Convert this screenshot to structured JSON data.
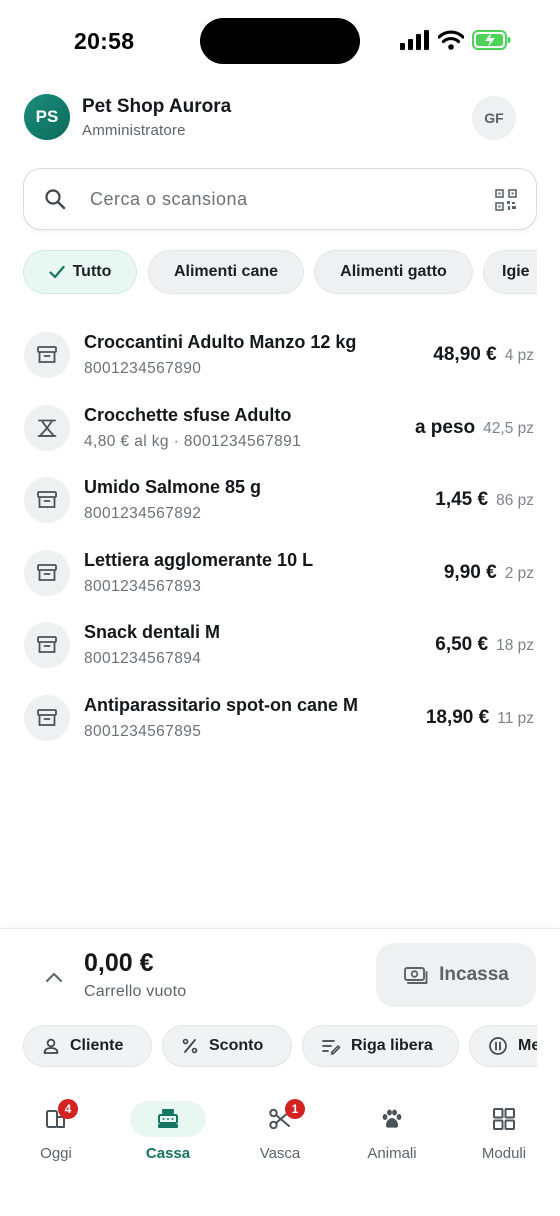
{
  "status_bar": {
    "time": "20:58"
  },
  "header": {
    "avatar_initials": "PS",
    "shop_name": "Pet Shop Aurora",
    "role": "Amministratore",
    "user_initials": "GF"
  },
  "search": {
    "placeholder": "Cerca o scansiona",
    "value": ""
  },
  "categories": [
    {
      "label": "Tutto",
      "active": true
    },
    {
      "label": "Alimenti cane",
      "active": false
    },
    {
      "label": "Alimenti gatto",
      "active": false
    },
    {
      "label": "Igie",
      "active": false
    }
  ],
  "products": [
    {
      "name": "Croccantini Adulto Manzo 12 kg",
      "subtitle": "8001234567890",
      "price": "48,90 €",
      "stock": "4 pz",
      "icon": "archive-box-icon"
    },
    {
      "name": "Crocchette sfuse Adulto",
      "subtitle": "4,80 € al kg · 8001234567891",
      "price": "a peso",
      "stock": "42,5 pz",
      "icon": "scale-icon"
    },
    {
      "name": "Umido Salmone 85 g",
      "subtitle": "8001234567892",
      "price": "1,45 €",
      "stock": "86 pz",
      "icon": "archive-box-icon"
    },
    {
      "name": "Lettiera agglomerante 10 L",
      "subtitle": "8001234567893",
      "price": "9,90 €",
      "stock": "2 pz",
      "icon": "archive-box-icon"
    },
    {
      "name": "Snack dentali M",
      "subtitle": "8001234567894",
      "price": "6,50 €",
      "stock": "18 pz",
      "icon": "archive-box-icon"
    },
    {
      "name": "Antiparassitario spot-on cane M",
      "subtitle": "8001234567895",
      "price": "18,90 €",
      "stock": "11 pz",
      "icon": "archive-box-icon"
    }
  ],
  "cart": {
    "total": "0,00 €",
    "status": "Carrello vuoto",
    "checkout_label": "Incassa"
  },
  "actions": [
    {
      "label": "Cliente",
      "icon": "user-icon"
    },
    {
      "label": "Sconto",
      "icon": "percent-icon"
    },
    {
      "label": "Riga libera",
      "icon": "free-line-icon"
    },
    {
      "label": "Me",
      "icon": "pause-circle-icon"
    }
  ],
  "tabs": [
    {
      "label": "Oggi",
      "icon": "today-icon",
      "badge": "4",
      "active": false
    },
    {
      "label": "Cassa",
      "icon": "cash-register-icon",
      "badge": "",
      "active": true
    },
    {
      "label": "Vasca",
      "icon": "scissors-icon",
      "badge": "1",
      "active": false
    },
    {
      "label": "Animali",
      "icon": "paw-icon",
      "badge": "",
      "active": false
    },
    {
      "label": "Moduli",
      "icon": "grid-icon",
      "badge": "",
      "active": false
    }
  ],
  "colors": {
    "accent": "#157563",
    "badge": "#d32222",
    "chip_active_bg": "#e9f7f3"
  }
}
